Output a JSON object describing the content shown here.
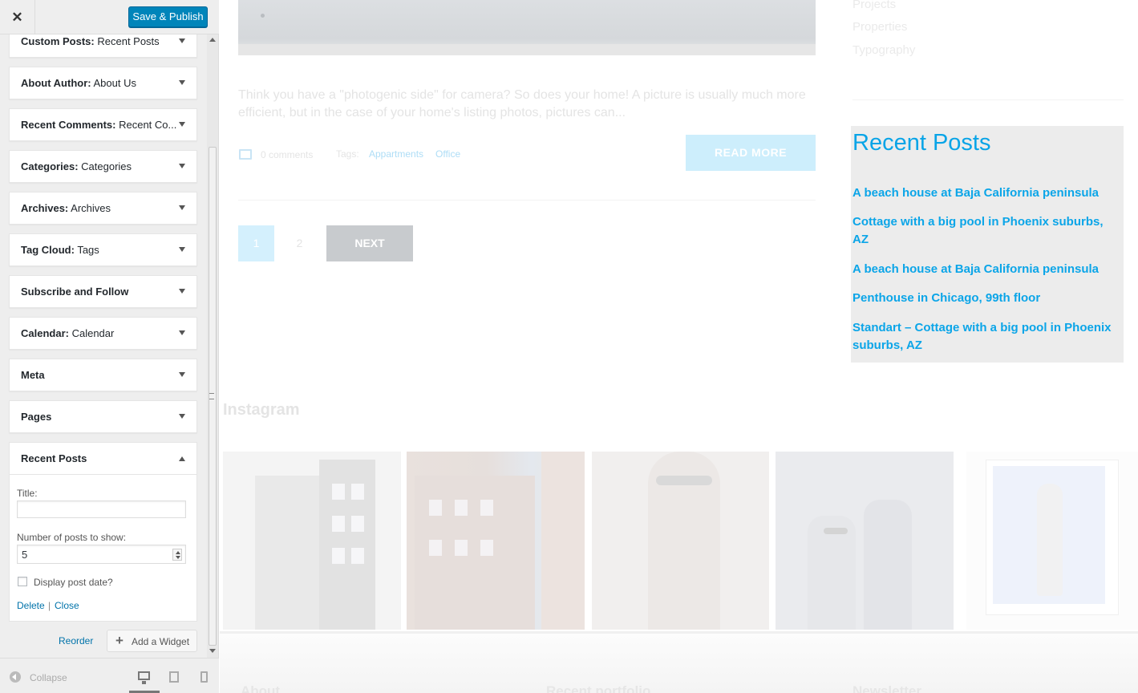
{
  "customizer": {
    "close_icon": "close-icon",
    "publish_label": "Save & Publish",
    "widgets": [
      {
        "type": "Custom Posts:",
        "title": "Recent Posts"
      },
      {
        "type": "About Author:",
        "title": "About Us"
      },
      {
        "type": "Recent Comments:",
        "title": "Recent Co..."
      },
      {
        "type": "Categories:",
        "title": "Categories"
      },
      {
        "type": "Archives:",
        "title": "Archives"
      },
      {
        "type": "Tag Cloud:",
        "title": "Tags"
      },
      {
        "type": "Subscribe and Follow",
        "title": ""
      },
      {
        "type": "Calendar:",
        "title": "Calendar"
      },
      {
        "type": "Meta",
        "title": ""
      },
      {
        "type": "Pages",
        "title": ""
      }
    ],
    "open_widget": {
      "name": "Recent Posts",
      "title_label": "Title:",
      "title_value": "",
      "number_label": "Number of posts to show:",
      "number_value": "5",
      "date_label": "Display post date?",
      "date_checked": false,
      "delete_label": "Delete",
      "separator": "|",
      "close_label": "Close"
    },
    "reorder_label": "Reorder",
    "add_widget_label": "Add a Widget",
    "collapse_label": "Collapse",
    "device_icons": [
      "desktop-icon",
      "tablet-icon",
      "mobile-icon"
    ],
    "active_device": "desktop"
  },
  "preview": {
    "excerpt": "Think you have a \"photogenic side\" for camera? So does your home! A picture is usually much more efficient, but in the case of your home's listing photos, pictures can...",
    "comments": "0 comments",
    "tags_label": "Tags:",
    "tags": [
      "Appartments",
      "Office"
    ],
    "read_more": "READ MORE",
    "pagination": {
      "pages": [
        "1",
        "2"
      ],
      "current": "1",
      "next": "NEXT"
    },
    "sidebar_links": [
      "Projects",
      "Properties",
      "Typography"
    ],
    "recent_posts": {
      "title": "Recent Posts",
      "items": [
        "A beach house at Baja California peninsula",
        "Cottage with a big pool in Phoenix suburbs, AZ",
        "A beach house at Baja California peninsula",
        "Penthouse in Chicago, 99th floor",
        "Standart – Cottage with a big pool in Phoenix suburbs, AZ"
      ]
    },
    "instagram_title": "Instagram",
    "footer_headings": [
      "About",
      "Recent portfolio",
      "Newsletter"
    ]
  },
  "colors": {
    "accent": "#0085ba",
    "link": "#0073aa",
    "recent_posts_link": "#0ba5e8"
  }
}
